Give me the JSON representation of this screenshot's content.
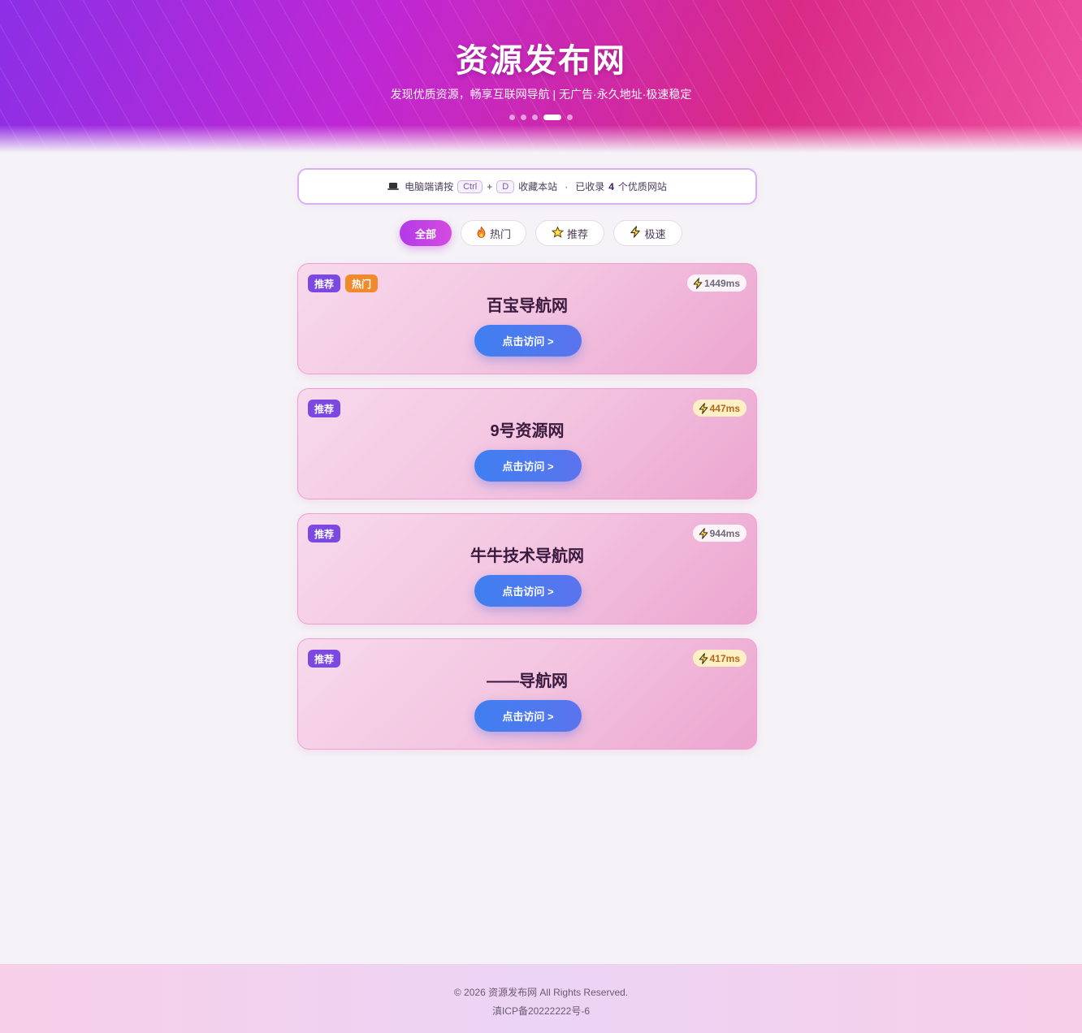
{
  "header": {
    "title": "资源发布网",
    "subtitle": "发现优质资源，畅享互联网导航 | 无广告·永久地址·极速稳定",
    "carousel_dots": 5,
    "active_dot": 4
  },
  "notice": {
    "prefix": "电脑端请按",
    "key1": "Ctrl",
    "plus": "+",
    "key2": "D",
    "suffix": "收藏本站",
    "sep": "·",
    "count_prefix": "已收录",
    "count": "4",
    "count_suffix": "个优质网站"
  },
  "filters": [
    {
      "label": "全部",
      "icon": "",
      "active": true
    },
    {
      "label": "热门",
      "icon": "fire-icon",
      "active": false
    },
    {
      "label": "推荐",
      "icon": "star-icon",
      "active": false
    },
    {
      "label": "极速",
      "icon": "lightning-icon",
      "active": false
    }
  ],
  "cards": [
    {
      "title": "百宝导航网",
      "badges": [
        "推荐",
        "热门"
      ],
      "speed": "1449ms",
      "speed_level": "slow",
      "button": "点击访问 >"
    },
    {
      "title": "9号资源网",
      "badges": [
        "推荐"
      ],
      "speed": "447ms",
      "speed_level": "mid",
      "button": "点击访问 >"
    },
    {
      "title": "牛牛技术导航网",
      "badges": [
        "推荐"
      ],
      "speed": "944ms",
      "speed_level": "slow",
      "button": "点击访问 >"
    },
    {
      "title": "——导航网",
      "badges": [
        "推荐"
      ],
      "speed": "417ms",
      "speed_level": "mid",
      "button": "点击访问 >"
    }
  ],
  "footer": {
    "copyright": "© 2026 资源发布网 All Rights Reserved.",
    "icp": "滇ICP备20222222号-6"
  },
  "colors": {
    "accent_purple": "#b23ae8",
    "button_blue": "#3f7ff0",
    "badge_recommend": "#7b48e0",
    "badge_hot": "#f08a2c"
  }
}
